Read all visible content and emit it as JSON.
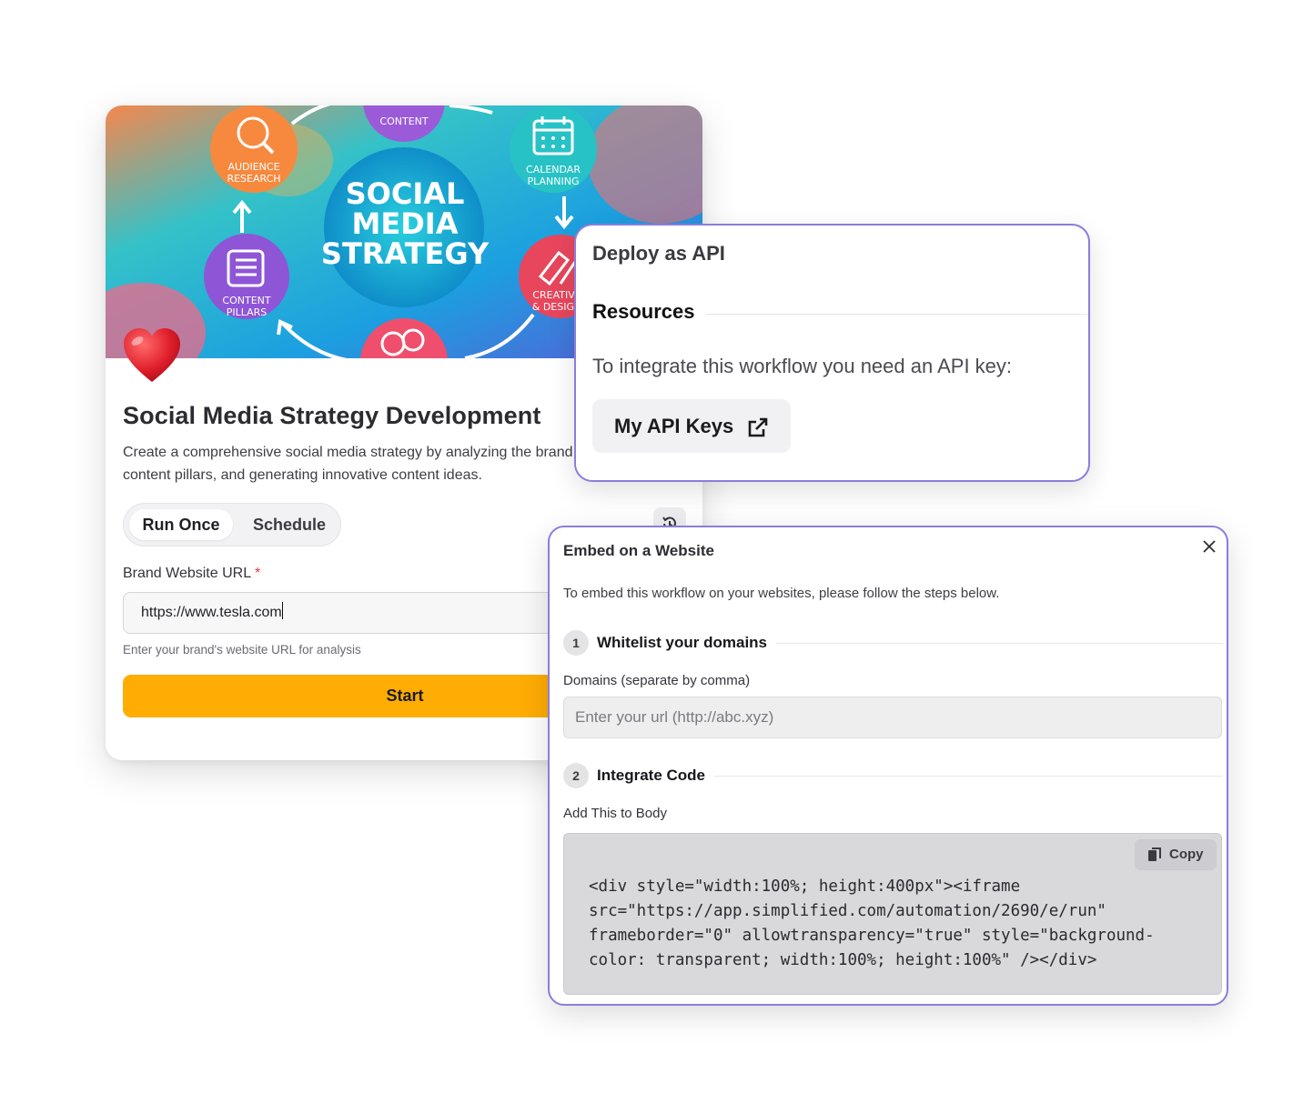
{
  "workflow_card": {
    "hero": {
      "title_lines": [
        "SOCIAL",
        "MEDIA",
        "STRATEGY"
      ],
      "nodes": {
        "audience": [
          "AUDIENCE",
          "RESEARCH"
        ],
        "content": "CONTENT",
        "calendar": [
          "CALENDAR",
          "PLANNING"
        ],
        "pillars": [
          "CONTENT",
          "PILLARS"
        ],
        "creative": [
          "CREATIVE",
          "& DESIGN"
        ]
      }
    },
    "title": "Social Media Strategy Development",
    "description": "Create a comprehensive social media strategy by analyzing the brand, identifying content pillars, and generating innovative content ideas.",
    "tabs": [
      "Run Once",
      "Schedule"
    ],
    "field_label": "Brand Website URL",
    "required_mark": "*",
    "url_value": "https://www.tesla.com",
    "hint": "Enter your brand's website URL for analysis",
    "start_label": "Start"
  },
  "api_panel": {
    "title": "Deploy as API",
    "resources_heading": "Resources",
    "text": "To integrate this workflow you need an API key:",
    "button_label": "My API Keys"
  },
  "embed_panel": {
    "title": "Embed on a Website",
    "intro": "To embed this workflow on your websites, please follow the steps below.",
    "step1": {
      "number": "1",
      "title": "Whitelist your domains"
    },
    "domains_label": "Domains (separate by comma)",
    "domains_placeholder": "Enter your url (http://abc.xyz)",
    "step2": {
      "number": "2",
      "title": "Integrate Code"
    },
    "code_label": "Add This to Body",
    "copy_label": "Copy",
    "code_lines": [
      "<div style=\"width:100%; height:400px\"><iframe",
      "src=\"https://app.simplified.com/automation/2690/e/run\"",
      "frameborder=\"0\" allowtransparency=\"true\" style=\"background-",
      "color: transparent; width:100%; height:100%\" /></div>"
    ]
  },
  "colors": {
    "accent_border": "#8b7ddb",
    "start_button": "#ffac04",
    "required": "#e0383e"
  },
  "icons": [
    "magnifier-icon",
    "calendar-icon",
    "document-icon",
    "pen-icon",
    "chat-bubbles-icon",
    "heart-icon",
    "history-icon",
    "external-link-icon",
    "close-icon",
    "copy-icon"
  ]
}
